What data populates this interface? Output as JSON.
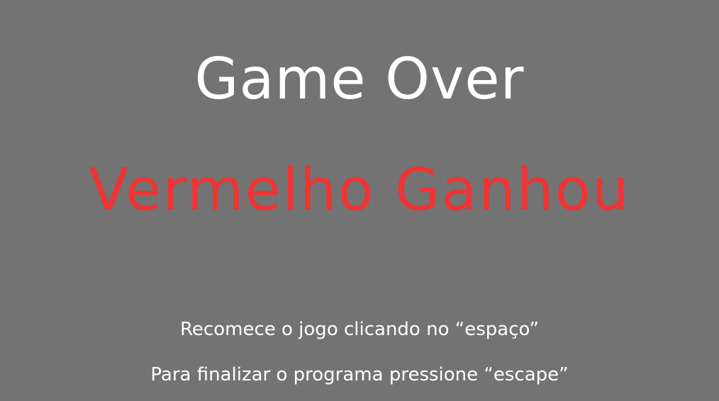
{
  "title": "Game Over",
  "winner": {
    "text": "Vermelho Ganhou",
    "color": "#ee3434"
  },
  "instructions": {
    "restart": "Recomece o jogo clicando no “espaço”",
    "exit": "Para finalizar o programa pressione “escape”"
  },
  "colors": {
    "background": "#737373",
    "text": "#ffffff"
  }
}
